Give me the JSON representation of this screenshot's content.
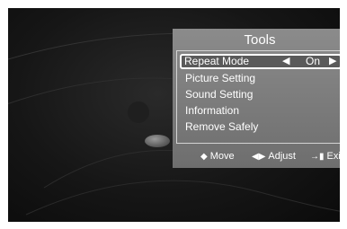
{
  "tools_menu": {
    "title": "Tools",
    "items": [
      {
        "label": "Repeat Mode",
        "value": "On",
        "selected": true
      },
      {
        "label": "Picture Setting"
      },
      {
        "label": "Sound Setting"
      },
      {
        "label": "Information"
      },
      {
        "label": "Remove Safely"
      }
    ]
  },
  "footer": {
    "move_label": "Move",
    "adjust_label": "Adjust",
    "exit_label": "Exit"
  },
  "colors": {
    "panel": "#7b7b7b",
    "background": "#161616",
    "text": "#ffffff"
  }
}
